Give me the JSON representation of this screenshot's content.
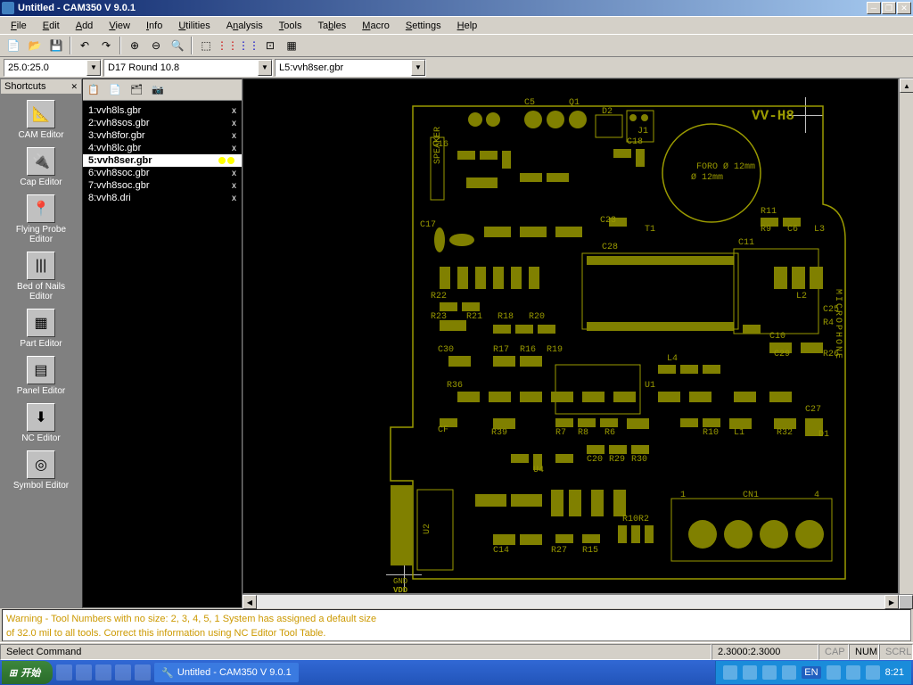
{
  "title": "Untitled - CAM350 V 9.0.1",
  "menus": [
    "File",
    "Edit",
    "Add",
    "View",
    "Info",
    "Utilities",
    "Analysis",
    "Tools",
    "Tables",
    "Macro",
    "Settings",
    "Help"
  ],
  "combos": {
    "coord": "25.0:25.0",
    "aperture": "D17   Round 10.8",
    "layer": "L5:vvh8ser.gbr"
  },
  "shortcuts_title": "Shortcuts",
  "shortcuts": [
    {
      "label": "CAM Editor",
      "icon": "📐"
    },
    {
      "label": "Cap Editor",
      "icon": "🔌"
    },
    {
      "label": "Flying Probe Editor",
      "icon": "📍"
    },
    {
      "label": "Bed of Nails Editor",
      "icon": "|||"
    },
    {
      "label": "Part Editor",
      "icon": "▦"
    },
    {
      "label": "Panel Editor",
      "icon": "▤"
    },
    {
      "label": "NC Editor",
      "icon": "⬇"
    },
    {
      "label": "Symbol Editor",
      "icon": "◎"
    }
  ],
  "layers": [
    {
      "n": "1",
      "name": "vvh8ls.gbr",
      "sel": false,
      "vis": "x"
    },
    {
      "n": "2",
      "name": "vvh8sos.gbr",
      "sel": false,
      "vis": "x"
    },
    {
      "n": "3",
      "name": "vvh8for.gbr",
      "sel": false,
      "vis": "x"
    },
    {
      "n": "4",
      "name": "vvh8lc.gbr",
      "sel": false,
      "vis": "x"
    },
    {
      "n": "5",
      "name": "vvh8ser.gbr",
      "sel": true,
      "vis": "●●"
    },
    {
      "n": "6",
      "name": "vvh8soc.gbr",
      "sel": false,
      "vis": "x"
    },
    {
      "n": "7",
      "name": "vvh8soc.gbr",
      "sel": false,
      "vis": "x"
    },
    {
      "n": "8",
      "name": "vvh8.dri",
      "sel": false,
      "vis": "x"
    }
  ],
  "pcb": {
    "board_label": "VV-H8",
    "speaker_label": "SPEAKER",
    "foro": "FORO\nØ 12mm",
    "micro": "MICROPHONE",
    "gnd": "GND",
    "vdd": "VDD",
    "refs": [
      "C5",
      "Q1",
      "D2",
      "J1",
      "C16",
      "C18",
      "C17",
      "C23",
      "T1",
      "R11",
      "C11",
      "R9",
      "C6",
      "L3",
      "C28",
      "C10",
      "L2",
      "C25",
      "R4",
      "R22",
      "R23",
      "R21",
      "R18",
      "R20",
      "C29",
      "C30",
      "R17",
      "R16",
      "R19",
      "U1",
      "L4",
      "L3",
      "C29",
      "R26",
      "R36",
      "CF",
      "R39",
      "R7",
      "R8",
      "R6",
      "R9",
      "R6",
      "R10",
      "L1",
      "R32",
      "C27",
      "D1",
      "U4",
      "C20",
      "R29",
      "R30",
      "CN1",
      "U2",
      "R27",
      "R15",
      "C14",
      "R10",
      "R2",
      "1",
      "4"
    ]
  },
  "console_l1": "Warning - Tool Numbers with no size: 2, 3, 4, 5, 1 System has assigned a default size",
  "console_l2": "of 32.0 mil to all tools. Correct this information using NC Editor Tool Table.",
  "status": {
    "left": "Select Command",
    "coords": "2.3000:2.3000",
    "cap": "CAP",
    "num": "NUM",
    "scrl": "SCRL"
  },
  "taskbar": {
    "start": "开始",
    "app": "Untitled - CAM350 V 9.0.1",
    "time": "8:21",
    "lang": "EN"
  }
}
